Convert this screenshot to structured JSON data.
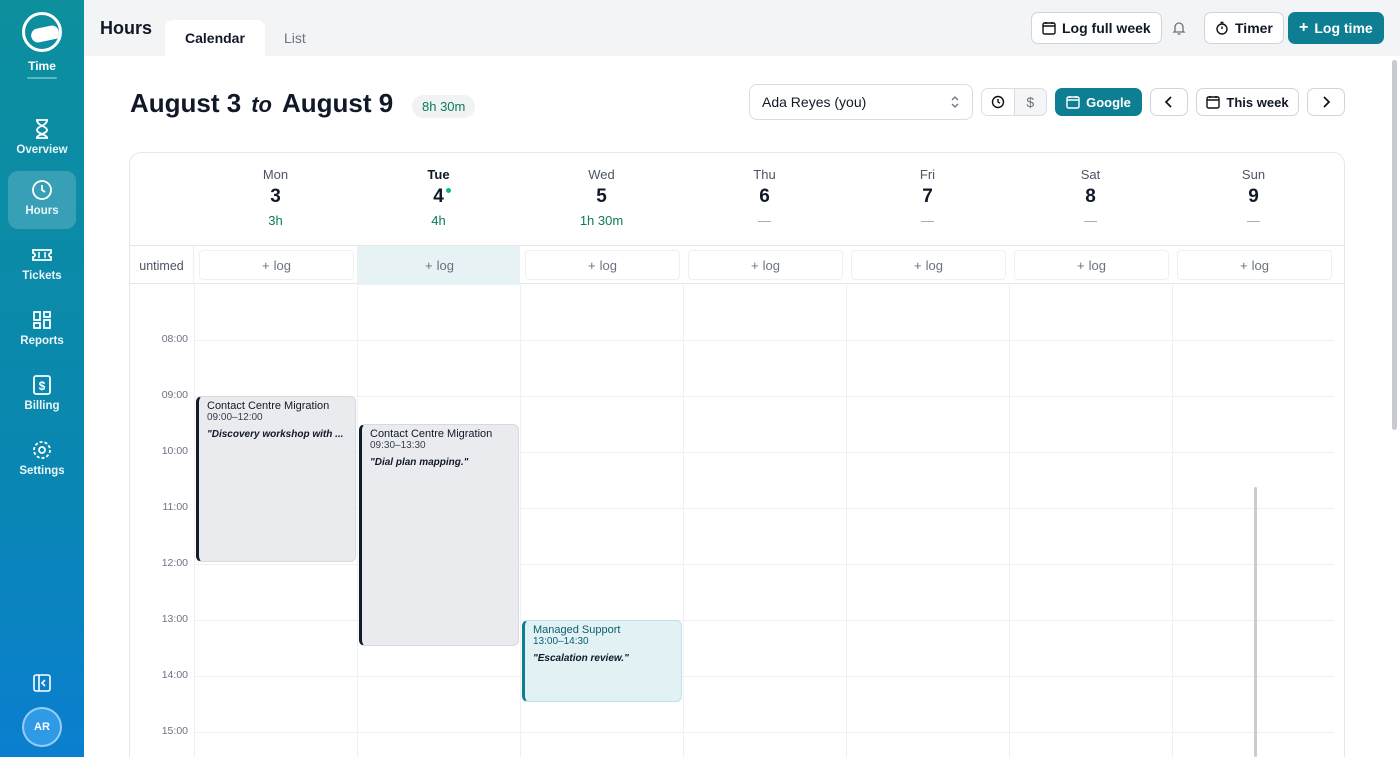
{
  "sidebar": {
    "brand_label": "Time",
    "items": [
      {
        "label": "Overview",
        "icon": "hourglass-icon"
      },
      {
        "label": "Hours",
        "icon": "clock-icon",
        "active": true
      },
      {
        "label": "Tickets",
        "icon": "ticket-icon"
      },
      {
        "label": "Reports",
        "icon": "grid-icon"
      },
      {
        "label": "Billing",
        "icon": "dollar-icon"
      },
      {
        "label": "Settings",
        "icon": "gear-icon"
      }
    ],
    "avatar_initials": "AR"
  },
  "topbar": {
    "page_title": "Hours",
    "tabs": [
      {
        "label": "Calendar",
        "active": true
      },
      {
        "label": "List"
      }
    ],
    "log_full_week_label": "Log full week",
    "timer_label": "Timer",
    "log_time_label": "Log time"
  },
  "header": {
    "start": "August 3",
    "to": "to",
    "end": "August 9",
    "total": "8h 30m",
    "user_select_value": "Ada Reyes (you)",
    "mode_dollar": "$",
    "google_label": "Google",
    "this_week_label": "This week"
  },
  "calendar": {
    "days": [
      {
        "dow": "Mon",
        "num": "3",
        "total": "3h"
      },
      {
        "dow": "Tue",
        "num": "4",
        "total": "4h",
        "today": true
      },
      {
        "dow": "Wed",
        "num": "5",
        "total": "1h 30m"
      },
      {
        "dow": "Thu",
        "num": "6",
        "total": "—"
      },
      {
        "dow": "Fri",
        "num": "7",
        "total": "—"
      },
      {
        "dow": "Sat",
        "num": "8",
        "total": "—"
      },
      {
        "dow": "Sun",
        "num": "9",
        "total": "—"
      }
    ],
    "untimed_label": "untimed",
    "log_label": "log",
    "hours": [
      "08:00",
      "09:00",
      "10:00",
      "11:00",
      "12:00",
      "13:00",
      "14:00",
      "15:00"
    ],
    "events": [
      {
        "day": 0,
        "name": "Contact Centre Migration",
        "time": "09:00–12:00",
        "note": "\"Discovery workshop with ...",
        "type": "project"
      },
      {
        "day": 1,
        "name": "Contact Centre Migration",
        "time": "09:30–13:30",
        "note": "\"Dial plan mapping.\"",
        "type": "project"
      },
      {
        "day": 2,
        "name": "Managed Support",
        "time": "13:00–14:30",
        "note": "\"Escalation review.\"",
        "type": "support"
      }
    ]
  },
  "colors": {
    "accent": "#0e7f93",
    "sidebar_top": "#0d8f9e",
    "sidebar_bottom": "#0a7fd0",
    "total_green": "#0b7a5e"
  }
}
